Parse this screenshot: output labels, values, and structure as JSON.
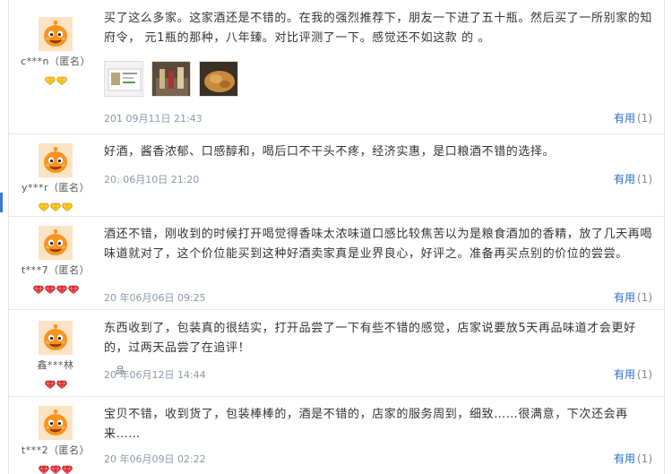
{
  "reviews": [
    {
      "username": "c***n（匿名）",
      "text": "买了这么多家。这家酒还是不错的。在我的强烈推荐下，朋友一下进了五十瓶。然后买了一所别家的知府令，  元1瓶的那种，八年臻。对比评测了一下。感觉还不如这款  的 。",
      "date": "201  09月11日 21:43",
      "helpful_label": "有用",
      "helpful_count": "(1)",
      "rank_icon": "gold-diamond",
      "rank_count": 2
    },
    {
      "username": "y***r（匿名）",
      "text": "好酒，酱香浓郁、口感醇和，喝后口不干头不疼，经济实惠，是口粮酒不错的选择。",
      "date": "20:  06月10日 21:20",
      "helpful_label": "有用",
      "helpful_count": "(1)",
      "rank_icon": "gold-diamond",
      "rank_count": 3
    },
    {
      "username": "t***7（匿名）",
      "text": "酒还不错，刚收到的时候打开喝觉得香味太浓味道口感比较焦苦以为是粮食酒加的香精，放了几天再喝味道就对了，这个价位能买到这种好酒卖家真是业界良心，好评之。准备再买点别的价位的尝尝。",
      "date": "20  年06月06日 09:25",
      "helpful_label": "有用",
      "helpful_count": "(1)",
      "rank_icon": "red-diamond",
      "rank_count": 4
    },
    {
      "username": "鑫***林",
      "text": "东西收到了，包装真的很结实，打开品尝了一下有些不错的感觉，店家说要放5天再品味道才会更好的，过两天品尝了在追评！",
      "date": "20  年06月12日 14:44",
      "stray": "品 ",
      "helpful_label": "有用",
      "helpful_count": "(1)",
      "rank_icon": "red-diamond",
      "rank_count": 2
    },
    {
      "username": "t***2（匿名）",
      "text": "宝贝不错，收到货了，包装棒棒的，酒是不错的，店家的服务周到，细致……很满意，下次还会再来……",
      "date": "20  年06月09日 02:22",
      "helpful_label": "有用",
      "helpful_count": "(1)",
      "rank_icon": "red-diamond",
      "rank_count": 3
    }
  ],
  "colors": {
    "link": "#2a6bc8",
    "meta": "#8a9aac",
    "avatar_bg": "#f7941d",
    "accent": "#3b78d8"
  }
}
